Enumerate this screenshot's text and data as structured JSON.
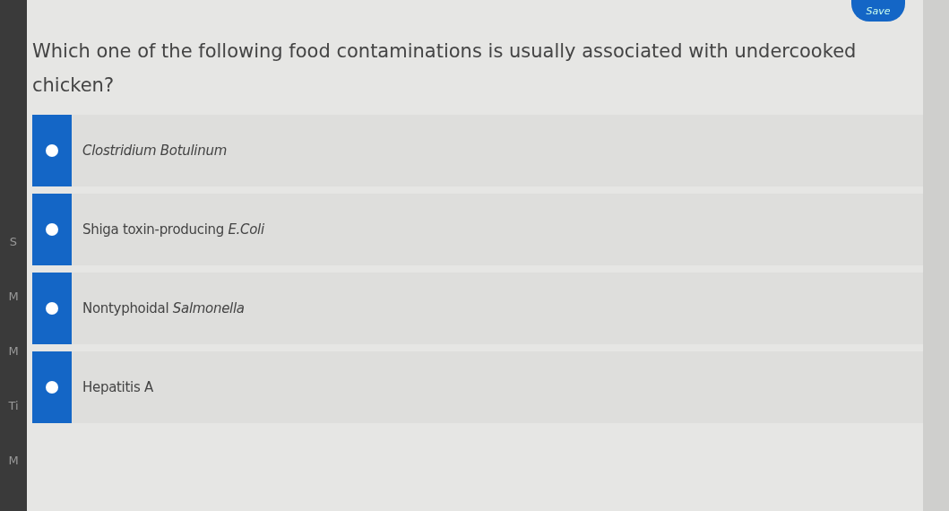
{
  "sidebar": {
    "items": [
      "S",
      "M",
      "M",
      "Ti",
      "M"
    ]
  },
  "save_button": {
    "label": "Save"
  },
  "question": {
    "text": "Which one of the following food contaminations is usually associated with undercooked chicken?"
  },
  "options": [
    {
      "label": "*Clostridium Botulinum*",
      "selected": false
    },
    {
      "label": "Shiga toxin-producing *E.Coli*",
      "selected": false
    },
    {
      "label": "Nontyphoidal *Salmonella*",
      "selected": false
    },
    {
      "label": "Hepatitis A",
      "selected": false
    }
  ]
}
